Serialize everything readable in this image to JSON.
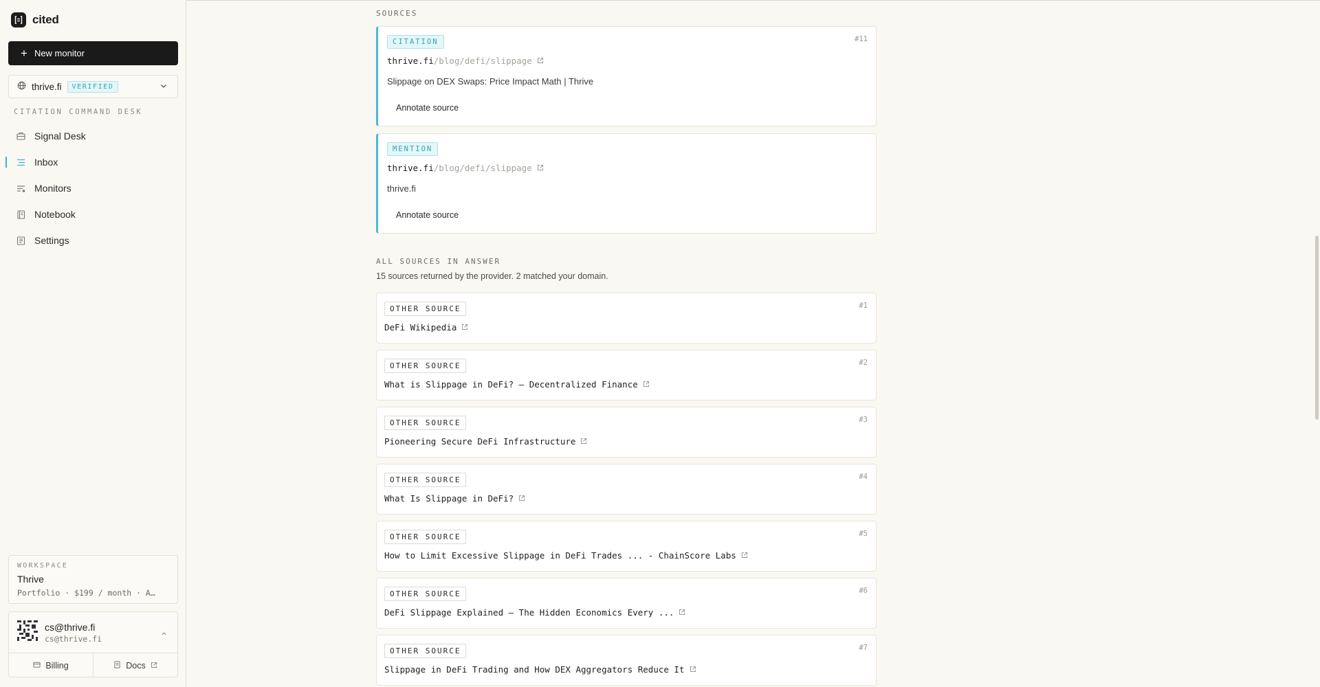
{
  "app": {
    "name": "cited"
  },
  "sidebar": {
    "new_monitor_label": "New monitor",
    "domain": {
      "name": "thrive.fi",
      "status": "VERIFIED"
    },
    "section_label": "CITATION COMMAND DESK",
    "nav": [
      {
        "label": "Signal Desk",
        "icon": "signal-desk-icon"
      },
      {
        "label": "Inbox",
        "icon": "inbox-icon",
        "active": true
      },
      {
        "label": "Monitors",
        "icon": "monitors-icon"
      },
      {
        "label": "Notebook",
        "icon": "notebook-icon"
      },
      {
        "label": "Settings",
        "icon": "settings-icon"
      }
    ],
    "workspace": {
      "label": "WORKSPACE",
      "name": "Thrive",
      "plan": "Portfolio · $199 / month · A…"
    },
    "account": {
      "name": "cs@thrive.fi",
      "email": "cs@thrive.fi",
      "billing_label": "Billing",
      "docs_label": "Docs"
    }
  },
  "main": {
    "sources_label": "SOURCES",
    "matched_sources": [
      {
        "tag": "CITATION",
        "num": "#11",
        "host": "thrive.fi",
        "path": "/blog/defi/slippage",
        "title": "Slippage on DEX Swaps: Price Impact Math | Thrive",
        "annotate_label": "Annotate source"
      },
      {
        "tag": "MENTION",
        "num": "",
        "host": "thrive.fi",
        "path": "/blog/defi/slippage",
        "title": "thrive.fi",
        "annotate_label": "Annotate source"
      }
    ],
    "all_sources_label": "ALL SOURCES IN ANSWER",
    "all_sources_summary": "15 sources returned by the provider. 2 matched your domain.",
    "other_sources": [
      {
        "tag": "OTHER SOURCE",
        "num": "#1",
        "title": "DeFi Wikipedia"
      },
      {
        "tag": "OTHER SOURCE",
        "num": "#2",
        "title": "What is Slippage in DeFi? — Decentralized Finance"
      },
      {
        "tag": "OTHER SOURCE",
        "num": "#3",
        "title": "Pioneering Secure DeFi Infrastructure"
      },
      {
        "tag": "OTHER SOURCE",
        "num": "#4",
        "title": "What Is Slippage in DeFi?"
      },
      {
        "tag": "OTHER SOURCE",
        "num": "#5",
        "title": "How to Limit Excessive Slippage in DeFi Trades ... - ChainScore Labs"
      },
      {
        "tag": "OTHER SOURCE",
        "num": "#6",
        "title": "DeFi Slippage Explained – The Hidden Economics Every ..."
      },
      {
        "tag": "OTHER SOURCE",
        "num": "#7",
        "title": "Slippage in DeFi Trading and How DEX Aggregators Reduce It"
      }
    ]
  },
  "colors": {
    "accent": "#46bcd2",
    "background": "#faf8f3",
    "primary_button": "#1a1a1a"
  }
}
